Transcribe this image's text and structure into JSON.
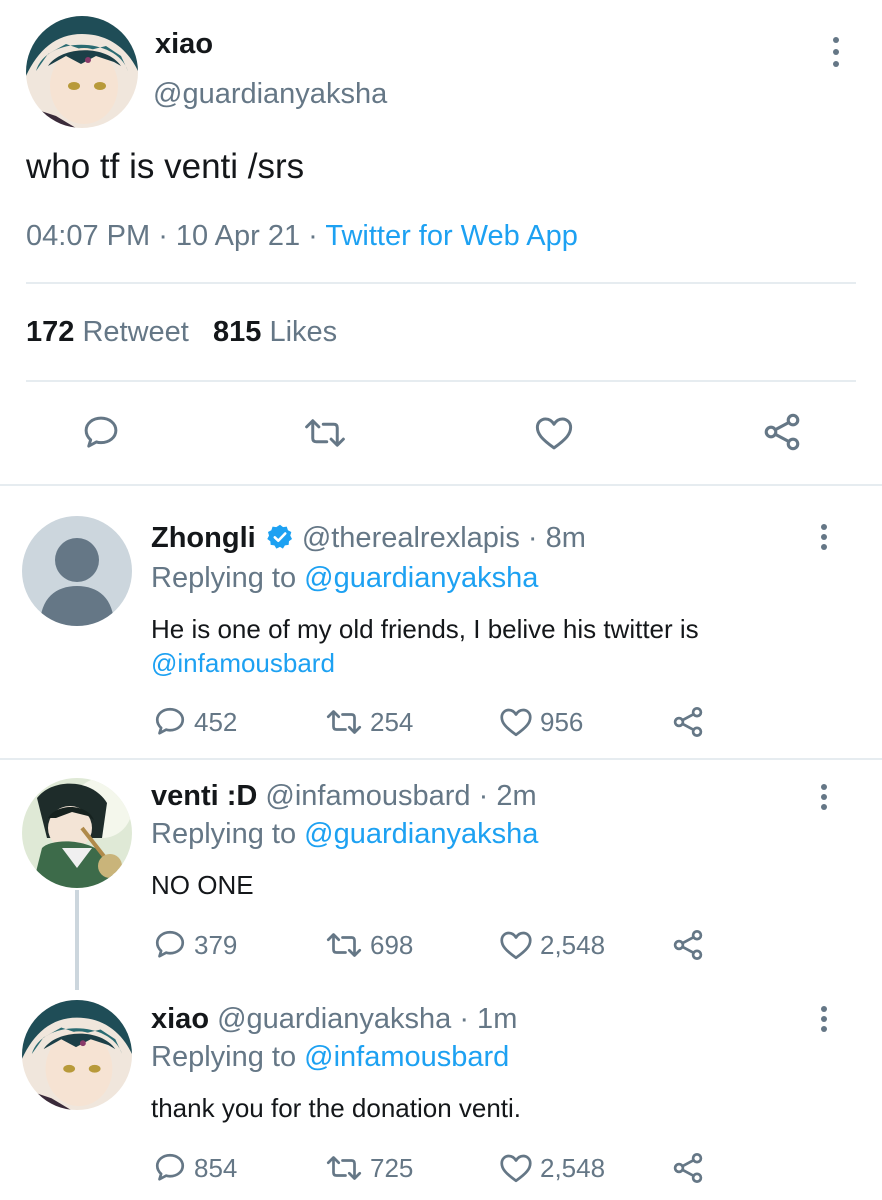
{
  "main_tweet": {
    "name": "xiao",
    "handle": "@guardianyaksha",
    "text": "who tf is venti /srs",
    "time": "04:07 PM",
    "sep1": " · ",
    "date": "10 Apr 21",
    "sep2": " · ",
    "source": "Twitter for Web App",
    "retweet_count": "172",
    "retweet_label": "Retweet",
    "likes_count": "815",
    "likes_label": "Likes"
  },
  "replies": [
    {
      "name": "Zhongli",
      "verified": true,
      "handle_time": "@therealrexlapis · 8m",
      "replying_label": "Replying to",
      "replying_to": "@guardianyaksha",
      "text_line1": "He is one of my old friends, I belive his twitter is",
      "text_mention": "@infamousbard",
      "replies": "452",
      "retweets": "254",
      "likes": "956"
    },
    {
      "name": "venti :D",
      "handle_time": "@infamousbard · 2m",
      "replying_label": "Replying to",
      "replying_to": "@guardianyaksha",
      "text": "NO ONE",
      "replies": "379",
      "retweets": "698",
      "likes": "2,548"
    },
    {
      "name": "xiao",
      "handle_time": "@guardianyaksha · 1m",
      "replying_label": "Replying to",
      "replying_to": "@infamousbard",
      "text": "thank you for the donation venti.",
      "replies": "854",
      "retweets": "725",
      "likes": "2,548"
    }
  ],
  "colors": {
    "link": "#1da1f2",
    "secondary_text": "#657786",
    "primary_text": "#14171a",
    "divider": "#e6ecf0",
    "verified": "#1da1f2"
  },
  "icons": [
    "more-icon",
    "reply-icon",
    "retweet-icon",
    "like-icon",
    "share-icon",
    "verified-icon"
  ]
}
